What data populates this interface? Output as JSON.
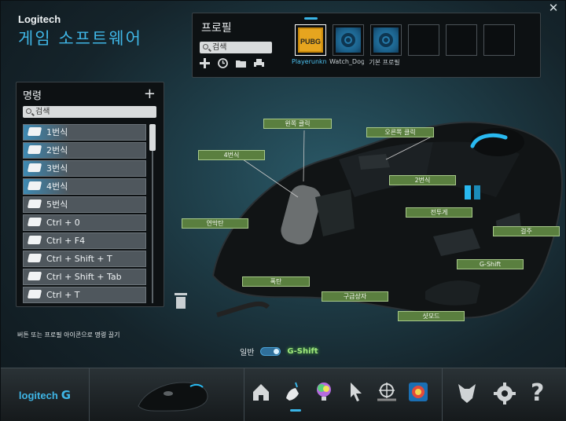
{
  "window": {
    "close_glyph": "✕",
    "brand": "Logitech",
    "title": "게임 소프트웨어",
    "accent": "#3fb6e6"
  },
  "profile": {
    "title": "프로필",
    "search_placeholder": "검색",
    "tools": [
      "add-icon",
      "clock-icon",
      "folder-icon",
      "printer-icon"
    ],
    "slots": [
      {
        "label": "Playerunknov",
        "icon": "pubg-icon",
        "active": true
      },
      {
        "label": "Watch_Dogs",
        "icon": "gear-icon",
        "active": false
      },
      {
        "label": "기본 프로필",
        "icon": "gear-icon",
        "active": false
      },
      {
        "label": "",
        "icon": "",
        "active": false
      },
      {
        "label": "",
        "icon": "",
        "active": false
      },
      {
        "label": "",
        "icon": "",
        "active": false
      }
    ]
  },
  "commands": {
    "title": "명령",
    "add_glyph": "+",
    "search_placeholder": "검색",
    "items": [
      {
        "label": "1번식",
        "highlight": true
      },
      {
        "label": "2번식",
        "highlight": true
      },
      {
        "label": "3번식",
        "highlight": true
      },
      {
        "label": "4번식",
        "highlight": true
      },
      {
        "label": "5번식",
        "highlight": false
      },
      {
        "label": "Ctrl + 0",
        "highlight": false
      },
      {
        "label": "Ctrl + F4",
        "highlight": false
      },
      {
        "label": "Ctrl + Shift + T",
        "highlight": false
      },
      {
        "label": "Ctrl + Shift + Tab",
        "highlight": false
      },
      {
        "label": "Ctrl + T",
        "highlight": false
      }
    ],
    "scroll_fraction": 0.15
  },
  "hint": "버튼 또는 프로필 아이콘으로 명령 끌기",
  "callouts": {
    "left_click": "왼쪽 클릭",
    "right_click": "오른쪽 클릭",
    "button4": "4번식",
    "button2": "2번식",
    "middle": "연막탄",
    "key_a": "전투게",
    "key_b": "걸주",
    "gshift": "G-Shift",
    "key_c": "폭탄",
    "key_d": "구급상자",
    "key_e": "샷모드"
  },
  "mode": {
    "normal": "일반",
    "gshift": "G-Shift",
    "active": "gshift"
  },
  "bottom": {
    "logo": "logitech",
    "logo_mark": "G",
    "icons": [
      "home-icon",
      "customize-buttons-icon",
      "lighting-icon",
      "pointer-settings-icon",
      "surface-tuning-icon",
      "heatmap-icon"
    ],
    "right_icons": [
      "arx-control-icon",
      "settings-icon",
      "help-icon"
    ],
    "help_glyph": "?"
  }
}
